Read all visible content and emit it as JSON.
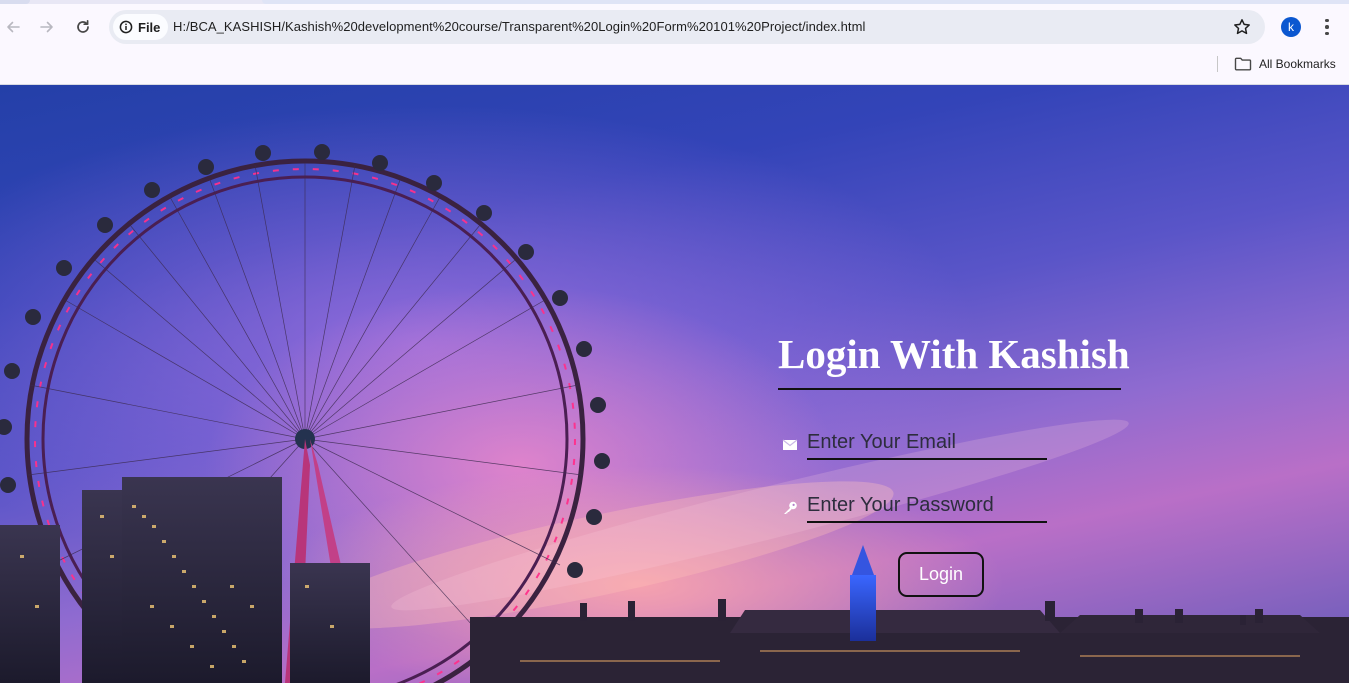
{
  "browser": {
    "chip_label": "File",
    "url": "H:/BCA_KASHISH/Kashish%20development%20course/Transparent%20Login%20Form%20101%20Project/index.html",
    "profile_initial": "k",
    "bookmarks_label": "All Bookmarks",
    "icons": {
      "back": "arrow-left-icon",
      "forward": "arrow-right-icon",
      "reload": "reload-icon",
      "site_info": "info-icon",
      "bookmark": "star-icon",
      "menu": "kebab-menu-icon",
      "bookmarks_folder": "folder-icon"
    }
  },
  "login": {
    "title": "Login With Kashish",
    "email_placeholder": "Enter Your Email",
    "password_placeholder": "Enter Your Password",
    "button_label": "Login",
    "email_icon": "envelope-icon",
    "password_icon": "key-icon"
  },
  "background": {
    "description_colors": {
      "sky_top": "#2440a8",
      "sky_glow": "#ffaaaa",
      "wheel_lights": "#ff2f8a"
    }
  }
}
